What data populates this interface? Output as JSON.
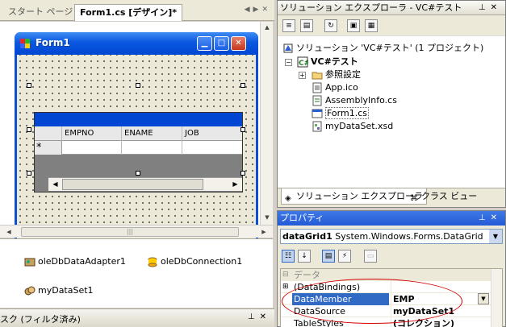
{
  "doc_tabs": {
    "start_page": "スタート ページ",
    "form_design": "Form1.cs [デザイン]*"
  },
  "form": {
    "title": "Form1"
  },
  "datagrid": {
    "columns": [
      "EMPNO",
      "ENAME",
      "JOB"
    ],
    "new_row_marker": "*"
  },
  "tray": {
    "items": [
      "oleDbDataAdapter1",
      "oleDbConnection1",
      "myDataSet1"
    ]
  },
  "task_list": {
    "title": "スク (フィルタ済み)"
  },
  "solution_explorer": {
    "title": "ソリューション エクスプローラ - VC#テスト",
    "solution": "ソリューション 'VC#テスト' (1 プロジェクト)",
    "project": "VC#テスト",
    "items": [
      "参照設定",
      "App.ico",
      "AssemblyInfo.cs",
      "Form1.cs",
      "myDataSet.xsd"
    ],
    "tabs": [
      "ソリューション エクスプローラ",
      "クラス ビュー"
    ]
  },
  "properties": {
    "title": "プロパティ",
    "object_name": "dataGrid1",
    "object_type": "System.Windows.Forms.DataGrid",
    "category": "データ",
    "rows": [
      {
        "name": "(DataBindings)",
        "value": ""
      },
      {
        "name": "DataMember",
        "value": "EMP"
      },
      {
        "name": "DataSource",
        "value": "myDataSet1"
      },
      {
        "name": "TableStyles",
        "value": "(コレクション)"
      }
    ]
  },
  "colors": {
    "titlebar_blue": "#0a58e0",
    "selection": "#316ac5",
    "annotation_red": "#d40000"
  }
}
